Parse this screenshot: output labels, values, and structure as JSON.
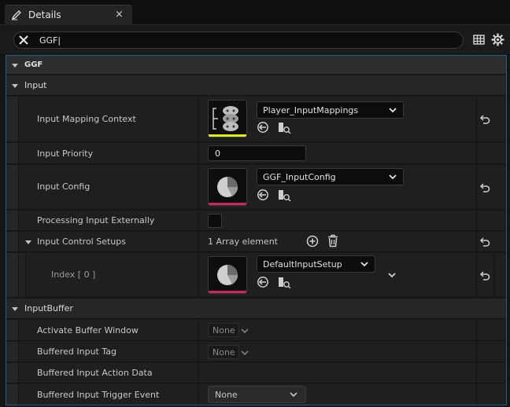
{
  "tab": {
    "title": "Details",
    "close": "×"
  },
  "search": {
    "value": "GGF|"
  },
  "categories": {
    "ggf": "GGF",
    "input": "Input",
    "input_buffer": "InputBuffer"
  },
  "rows": {
    "input_mapping_context": {
      "label": "Input Mapping Context",
      "asset": "Player_InputMappings",
      "thumb_bar_color": "#e5e52a"
    },
    "input_priority": {
      "label": "Input Priority",
      "value": "0"
    },
    "input_config": {
      "label": "Input Config",
      "asset": "GGF_InputConfig",
      "thumb_bar_color": "#c8295a"
    },
    "processing_input_externally": {
      "label": "Processing Input Externally",
      "checked": false
    },
    "input_control_setups": {
      "label": "Input Control Setups",
      "count": "1 Array element"
    },
    "index0": {
      "label": "Index [ 0 ]",
      "asset": "DefaultInputSetup",
      "thumb_bar_color": "#c8295a"
    },
    "activate_buffer_window": {
      "label": "Activate Buffer Window",
      "value": "None"
    },
    "buffered_input_tag": {
      "label": "Buffered Input Tag",
      "value": "None"
    },
    "buffered_input_action_data": {
      "label": "Buffered Input Action Data"
    },
    "buffered_input_trigger_event": {
      "label": "Buffered Input Trigger Event",
      "value": "None"
    }
  },
  "colors": {
    "accent_border": "#2d5a8a",
    "background": "#151515"
  }
}
